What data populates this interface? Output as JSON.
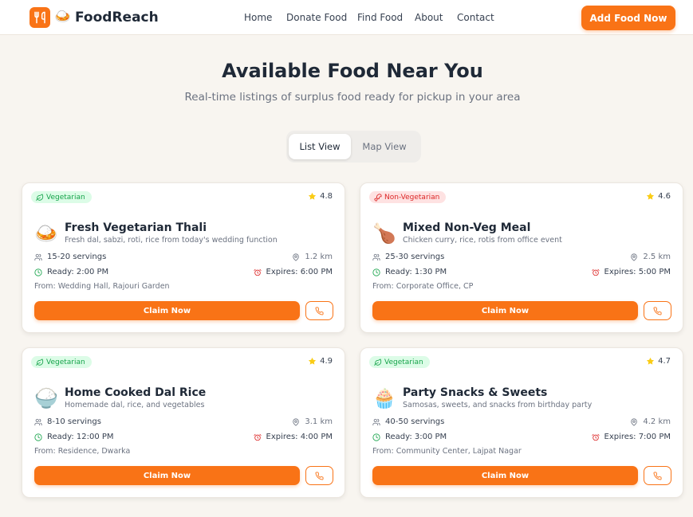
{
  "brand": {
    "name": "FoodReach",
    "emoji": "🍛",
    "logo_icon": "utensils-icon",
    "accent": "#f97316"
  },
  "nav": {
    "links": [
      "Home",
      "Donate Food",
      "Find Food",
      "About",
      "Contact"
    ],
    "cta": "Add Food Now"
  },
  "hero": {
    "title": "Available Food Near You",
    "subtitle": "Real-time listings of surplus food ready for pickup in your area"
  },
  "view_toggle": {
    "options": [
      "List View",
      "Map View"
    ],
    "selected": "List View"
  },
  "listings": [
    {
      "tag": "Vegetarian",
      "tag_type": "veg",
      "rating": "4.8",
      "emoji": "🍛",
      "title": "Fresh Vegetarian Thali",
      "description": "Fresh dal, sabzi, roti, rice from today's wedding function",
      "servings": "15-20 servings",
      "distance": "1.2 km",
      "ready": "Ready: 2:00 PM",
      "expires": "Expires: 6:00 PM",
      "from": "From: Wedding Hall, Rajouri Garden",
      "claim_label": "Claim Now"
    },
    {
      "tag": "Non-Vegetarian",
      "tag_type": "nonveg",
      "rating": "4.6",
      "emoji": "🍗",
      "title": "Mixed Non-Veg Meal",
      "description": "Chicken curry, rice, rotis from office event",
      "servings": "25-30 servings",
      "distance": "2.5 km",
      "ready": "Ready: 1:30 PM",
      "expires": "Expires: 5:00 PM",
      "from": "From: Corporate Office, CP",
      "claim_label": "Claim Now"
    },
    {
      "tag": "Vegetarian",
      "tag_type": "veg",
      "rating": "4.9",
      "emoji": "🍚",
      "title": "Home Cooked Dal Rice",
      "description": "Homemade dal, rice, and vegetables",
      "servings": "8-10 servings",
      "distance": "3.1 km",
      "ready": "Ready: 12:00 PM",
      "expires": "Expires: 4:00 PM",
      "from": "From: Residence, Dwarka",
      "claim_label": "Claim Now"
    },
    {
      "tag": "Vegetarian",
      "tag_type": "veg",
      "rating": "4.7",
      "emoji": "🧁",
      "title": "Party Snacks & Sweets",
      "description": "Samosas, sweets, and snacks from birthday party",
      "servings": "40-50 servings",
      "distance": "4.2 km",
      "ready": "Ready: 3:00 PM",
      "expires": "Expires: 7:00 PM",
      "from": "From: Community Center, Lajpat Nagar",
      "claim_label": "Claim Now"
    }
  ],
  "icons": {
    "tag_veg": "leaf-icon",
    "tag_nonveg": "drumstick-icon",
    "rating": "star-icon",
    "servings": "users-icon",
    "distance": "map-pin-icon",
    "ready": "clock-icon",
    "expires": "alarm-clock-icon",
    "phone": "phone-icon"
  },
  "colors": {
    "veg": "#16a34a",
    "nonveg": "#dc2626",
    "star": "#facc15",
    "page_bg": "#f8f5f0"
  }
}
